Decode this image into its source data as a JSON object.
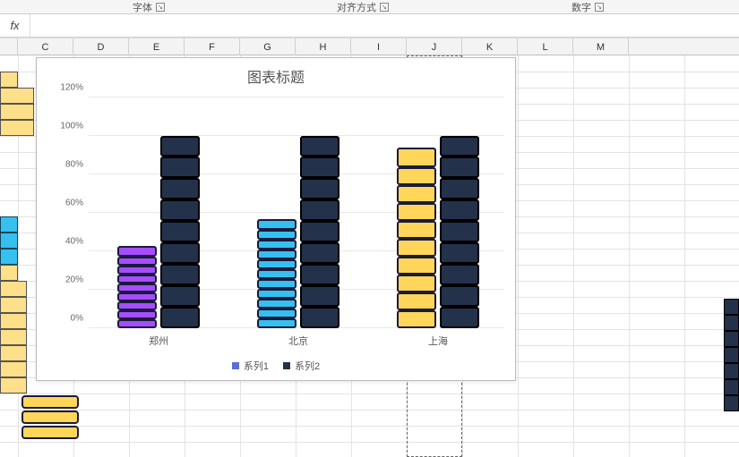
{
  "ribbon": {
    "font_group": "字体",
    "align_group": "对齐方式",
    "number_group": "数字"
  },
  "formula_bar": {
    "fx": "fx",
    "value": ""
  },
  "columns": [
    "C",
    "D",
    "E",
    "F",
    "G",
    "H",
    "I",
    "J",
    "K",
    "L",
    "M"
  ],
  "chart": {
    "title": "图表标题",
    "yticks": [
      "0%",
      "20%",
      "40%",
      "60%",
      "80%",
      "100%",
      "120%"
    ],
    "legend": {
      "s1": "系列1",
      "s2": "系列2"
    },
    "categories": [
      "郑州",
      "北京",
      "上海"
    ]
  },
  "chart_data": {
    "type": "bar",
    "title": "图表标题",
    "xlabel": "",
    "ylabel": "",
    "ylim": [
      0,
      120
    ],
    "categories": [
      "郑州",
      "北京",
      "上海"
    ],
    "series": [
      {
        "name": "系列1",
        "values": [
          43,
          57,
          94
        ]
      },
      {
        "name": "系列2",
        "values": [
          100,
          100,
          100
        ]
      }
    ]
  }
}
